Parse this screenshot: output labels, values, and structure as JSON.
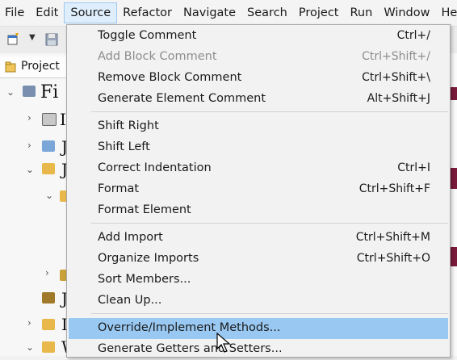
{
  "menubar": {
    "items": [
      "File",
      "Edit",
      "Source",
      "Refactor",
      "Navigate",
      "Search",
      "Project",
      "Run",
      "Window",
      "He"
    ],
    "active": "Source"
  },
  "project_panel": {
    "tab_label": "Project",
    "tree_glyphs": [
      "Fi",
      "I",
      "J",
      "J",
      "J",
      "I",
      "W"
    ]
  },
  "source_menu": {
    "groups": [
      [
        {
          "label": "Toggle Comment",
          "shortcut": "Ctrl+/",
          "enabled": true
        },
        {
          "label": "Add Block Comment",
          "shortcut": "Ctrl+Shift+/",
          "enabled": false
        },
        {
          "label": "Remove Block Comment",
          "shortcut": "Ctrl+Shift+\\",
          "enabled": true
        },
        {
          "label": "Generate Element Comment",
          "shortcut": "Alt+Shift+J",
          "enabled": true
        }
      ],
      [
        {
          "label": "Shift Right",
          "shortcut": "",
          "enabled": true
        },
        {
          "label": "Shift Left",
          "shortcut": "",
          "enabled": true
        },
        {
          "label": "Correct Indentation",
          "shortcut": "Ctrl+I",
          "enabled": true
        },
        {
          "label": "Format",
          "shortcut": "Ctrl+Shift+F",
          "enabled": true
        },
        {
          "label": "Format Element",
          "shortcut": "",
          "enabled": true
        }
      ],
      [
        {
          "label": "Add Import",
          "shortcut": "Ctrl+Shift+M",
          "enabled": true
        },
        {
          "label": "Organize Imports",
          "shortcut": "Ctrl+Shift+O",
          "enabled": true
        },
        {
          "label": "Sort Members...",
          "shortcut": "",
          "enabled": true
        },
        {
          "label": "Clean Up...",
          "shortcut": "",
          "enabled": true
        }
      ],
      [
        {
          "label": "Override/Implement Methods...",
          "shortcut": "",
          "enabled": true,
          "highlighted": true
        },
        {
          "label": "Generate Getters and Setters...",
          "shortcut": "",
          "enabled": true
        }
      ]
    ]
  },
  "colors": {
    "highlight": "#99c9f2",
    "menu_bg": "#f2f2f2",
    "disabled_text": "#8d8d8d",
    "editor_accent": "#7a1a3a"
  }
}
